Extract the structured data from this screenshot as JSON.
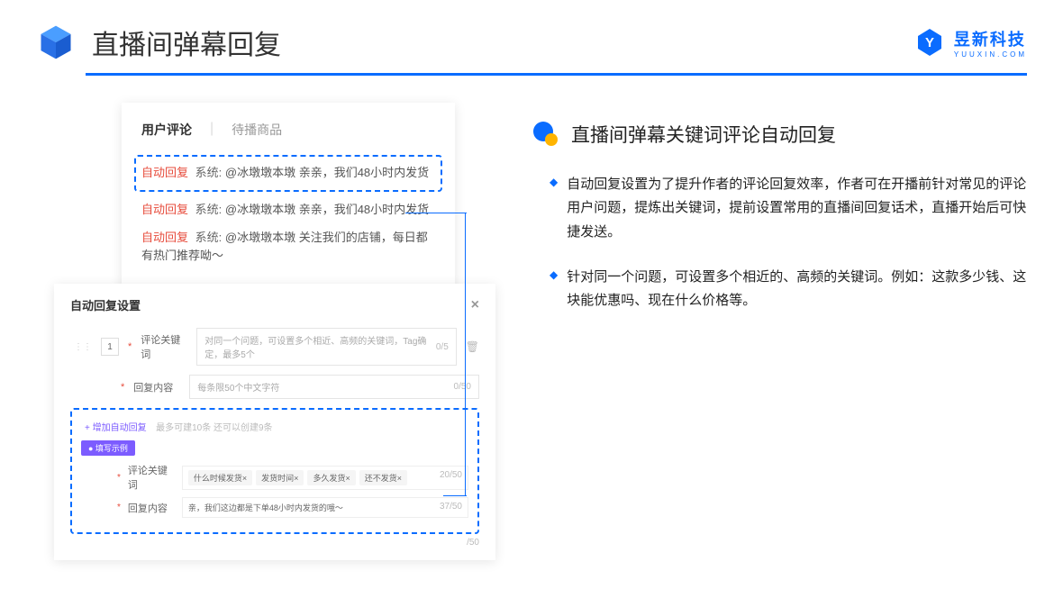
{
  "header": {
    "title": "直播间弹幕回复",
    "brand_name": "昱新科技",
    "brand_sub": "YUUXIN.COM"
  },
  "card": {
    "tab1": "用户评论",
    "tab2": "待播商品",
    "c1_tag": "自动回复",
    "c1_sys": "系统:",
    "c1_text": "@冰墩墩本墩 亲亲，我们48小时内发货",
    "c2_tag": "自动回复",
    "c2_sys": "系统:",
    "c2_text": "@冰墩墩本墩 亲亲，我们48小时内发货",
    "c3_tag": "自动回复",
    "c3_sys": "系统:",
    "c3_text": "@冰墩墩本墩 关注我们的店铺，每日都有热门推荐呦～"
  },
  "settings": {
    "title": "自动回复设置",
    "idx": "1",
    "kw_label": "评论关键词",
    "kw_ph": "对同一个问题，可设置多个相近、高频的关键词，Tag确定，最多5个",
    "kw_count": "0/5",
    "reply_label": "回复内容",
    "reply_ph": "每条限50个中文字符",
    "reply_count": "0/50",
    "add": "+ 增加自动回复",
    "add_hint": "最多可建10条 还可以创建9条",
    "badge": "● 填写示例",
    "ex_kw_label": "评论关键词",
    "t1": "什么时候发货×",
    "t2": "发货时间×",
    "t3": "多久发货×",
    "t4": "还不发货×",
    "ex_kw_count": "20/50",
    "ex_reply_label": "回复内容",
    "ex_reply": "亲，我们这边都是下单48小时内发货的哦～",
    "ex_reply_count": "37/50",
    "bottom_count": "/50"
  },
  "right": {
    "title": "直播间弹幕关键词评论自动回复",
    "b1": "自动回复设置为了提升作者的评论回复效率，作者可在开播前针对常见的评论用户问题，提炼出关键词，提前设置常用的直播间回复话术，直播开始后可快捷发送。",
    "b2": "针对同一个问题，可设置多个相近的、高频的关键词。例如：这款多少钱、这块能优惠吗、现在什么价格等。"
  }
}
